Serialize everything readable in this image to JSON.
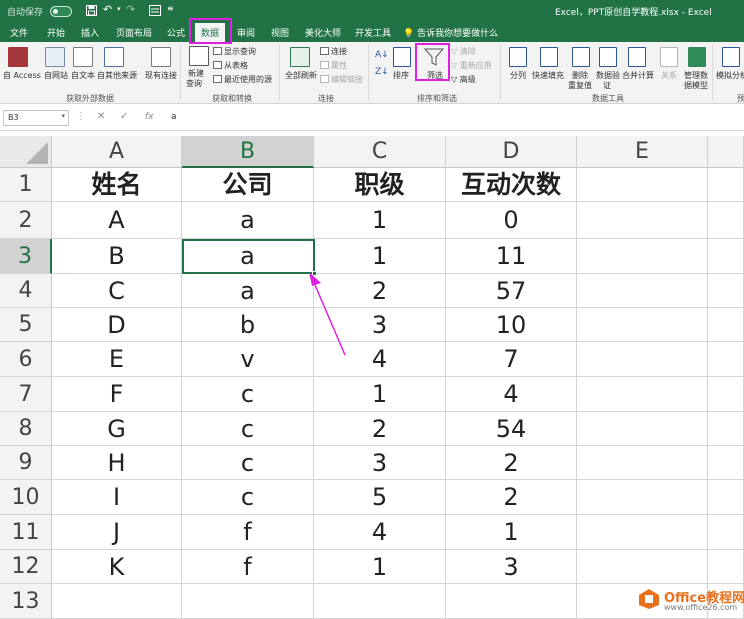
{
  "window": {
    "autosave_label": "自动保存",
    "title": "Excel，PPT原创自学教程.xlsx  -  Excel"
  },
  "tabs": [
    "文件",
    "开始",
    "插入",
    "页面布局",
    "公式",
    "数据",
    "审阅",
    "视图",
    "美化大师",
    "开发工具"
  ],
  "active_tab": "数据",
  "tell_me": "告诉我你想要做什么",
  "ribbon": {
    "get_external": {
      "access": "自 Access",
      "web": "自网站",
      "text": "自文本",
      "other": "自其他来源",
      "existing": "现有连接",
      "group_label": "获取外部数据"
    },
    "transform": {
      "new_query_1": "新建",
      "new_query_2": "查询",
      "show_queries": "显示查询",
      "from_table": "从表格",
      "recent_sources": "最近使用的源",
      "group_label": "获取和转换"
    },
    "connections": {
      "refresh_all": "全部刷新",
      "connections": "连接",
      "properties": "属性",
      "edit_links": "编辑链接",
      "group_label": "连接"
    },
    "sort_filter": {
      "sort": "排序",
      "filter": "筛选",
      "clear": "清除",
      "reapply": "重新应用",
      "advanced": "高级",
      "group_label": "排序和筛选"
    },
    "data_tools": {
      "split": "分列",
      "flash_fill": "快速填充",
      "remove_dup_1": "删除",
      "remove_dup_2": "重复值",
      "validation_1": "数据验",
      "validation_2": "证",
      "consolidate": "合并计算",
      "relations": "关系",
      "manage_model_1": "管理数",
      "manage_model_2": "据模型",
      "group_label": "数据工具"
    },
    "forecast": {
      "whatif": "模拟分析",
      "group_label": "预"
    }
  },
  "formula_bar": {
    "name_box": "B3",
    "fx": "fx",
    "value": "a"
  },
  "columns": [
    "A",
    "B",
    "C",
    "D",
    "E"
  ],
  "selected_column": "B",
  "row_numbers": [
    "1",
    "2",
    "3",
    "4",
    "5",
    "6",
    "7",
    "8",
    "9",
    "10",
    "11",
    "12",
    "13"
  ],
  "selected_row": "3",
  "table": {
    "headers": [
      "姓名",
      "公司",
      "职级",
      "互动次数"
    ],
    "rows": [
      [
        "A",
        "a",
        "1",
        "0"
      ],
      [
        "B",
        "a",
        "1",
        "11"
      ],
      [
        "C",
        "a",
        "2",
        "57"
      ],
      [
        "D",
        "b",
        "3",
        "10"
      ],
      [
        "E",
        "v",
        "4",
        "7"
      ],
      [
        "F",
        "c",
        "1",
        "4"
      ],
      [
        "G",
        "c",
        "2",
        "54"
      ],
      [
        "H",
        "c",
        "3",
        "2"
      ],
      [
        "I",
        "c",
        "5",
        "2"
      ],
      [
        "J",
        "f",
        "4",
        "1"
      ],
      [
        "K",
        "f",
        "1",
        "3"
      ]
    ]
  },
  "watermark": {
    "brand": "Office教程网",
    "url": "www.office26.com"
  },
  "colors": {
    "excel_green": "#217346",
    "annotation_magenta": "#e020e0",
    "watermark_orange": "#e8711e"
  }
}
